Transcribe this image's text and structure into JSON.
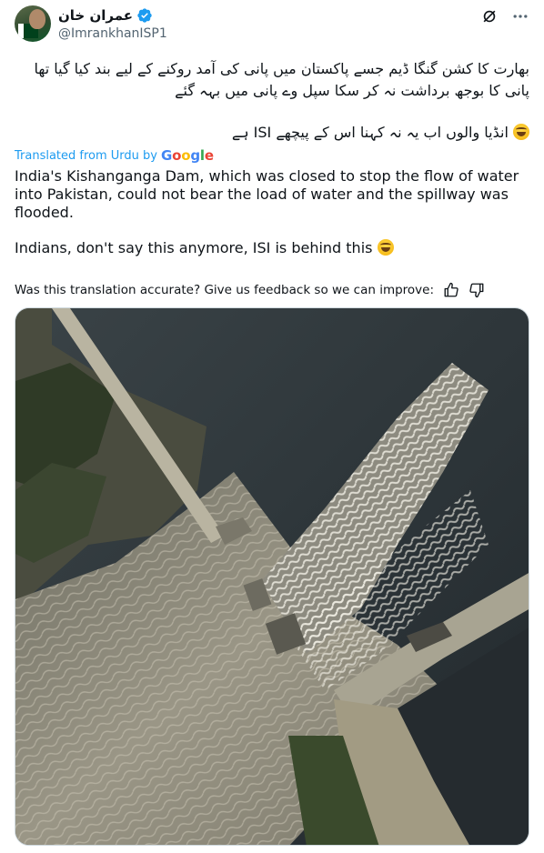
{
  "author": {
    "display_name": "عمران خان",
    "handle": "@ImrankhanISP1",
    "verified": true
  },
  "icons": {
    "grok": "grok-icon",
    "more": "more-icon",
    "verified": "verified-badge-icon",
    "thumbs_up": "thumbs-up-icon",
    "thumbs_down": "thumbs-down-icon"
  },
  "tweet": {
    "urdu_line1": "بھارت کا کشن گنگا ڈیم جسے پاکستان میں پانی کی آمد روکنے کے لیے بند کیا گیا تھا",
    "urdu_line2": "پانی کا بوجھ برداشت نہ کر سکا سپل وے پانی میں بہہ گئے",
    "urdu_line3": "انڈیا والوں اب یہ نہ کہنا اس کے پیچھے ISI ہے",
    "translated_from": "Translated from Urdu by",
    "translator": "Google",
    "english_p1": "India's Kishanganga Dam, which was closed to stop the flow of water into Pakistan, could not bear the load of water and the spillway was flooded.",
    "english_p2": "Indians, don't say this anymore, ISI is behind this",
    "feedback_prompt": "Was this translation accurate? Give us feedback so we can improve:"
  },
  "colors": {
    "link_blue": "#1d9bf0",
    "secondary_text": "#536471",
    "water_dark": "#2a3136",
    "flood_water": "#8e8a7a"
  }
}
